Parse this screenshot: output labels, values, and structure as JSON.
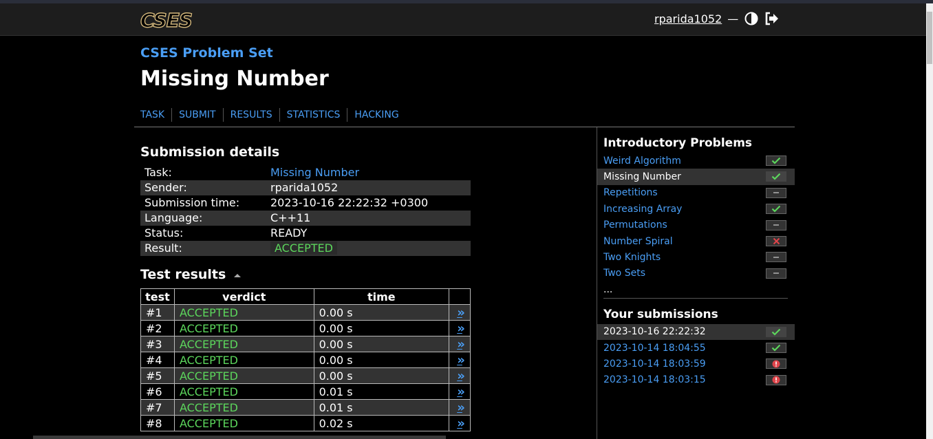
{
  "header": {
    "logo": "CSES",
    "username": "rparida1052",
    "separator": "—",
    "theme_icon": "contrast-icon",
    "logout_icon": "logout-icon"
  },
  "breadcrumb": "CSES Problem Set",
  "page_title": "Missing Number",
  "tabs": [
    {
      "label": "TASK"
    },
    {
      "label": "SUBMIT"
    },
    {
      "label": "RESULTS"
    },
    {
      "label": "STATISTICS"
    },
    {
      "label": "HACKING"
    }
  ],
  "details": {
    "heading": "Submission details",
    "task_label": "Task:",
    "task_value": "Missing Number",
    "sender_label": "Sender:",
    "sender_value": "rparida1052",
    "time_label": "Submission time:",
    "time_value": "2023-10-16 22:22:32 +0300",
    "language_label": "Language:",
    "language_value": "C++11",
    "status_label": "Status:",
    "status_value": "READY",
    "result_label": "Result:",
    "result_value": "ACCEPTED"
  },
  "tests": {
    "heading": "Test results",
    "columns": [
      "test",
      "verdict",
      "time"
    ],
    "link_glyph": "»",
    "rows": [
      {
        "test": "#1",
        "verdict": "ACCEPTED",
        "time": "0.00 s"
      },
      {
        "test": "#2",
        "verdict": "ACCEPTED",
        "time": "0.00 s"
      },
      {
        "test": "#3",
        "verdict": "ACCEPTED",
        "time": "0.00 s"
      },
      {
        "test": "#4",
        "verdict": "ACCEPTED",
        "time": "0.00 s"
      },
      {
        "test": "#5",
        "verdict": "ACCEPTED",
        "time": "0.00 s"
      },
      {
        "test": "#6",
        "verdict": "ACCEPTED",
        "time": "0.01 s"
      },
      {
        "test": "#7",
        "verdict": "ACCEPTED",
        "time": "0.01 s"
      },
      {
        "test": "#8",
        "verdict": "ACCEPTED",
        "time": "0.02 s"
      }
    ]
  },
  "sidebar": {
    "problems_heading": "Introductory Problems",
    "problems": [
      {
        "label": "Weird Algorithm",
        "status": "check"
      },
      {
        "label": "Missing Number",
        "status": "check",
        "current": true
      },
      {
        "label": "Repetitions",
        "status": "dash"
      },
      {
        "label": "Increasing Array",
        "status": "check"
      },
      {
        "label": "Permutations",
        "status": "dash"
      },
      {
        "label": "Number Spiral",
        "status": "cross"
      },
      {
        "label": "Two Knights",
        "status": "dash"
      },
      {
        "label": "Two Sets",
        "status": "dash"
      }
    ],
    "more": "...",
    "submissions_heading": "Your submissions",
    "submissions": [
      {
        "label": "2023-10-16 22:22:32",
        "status": "check",
        "current": true
      },
      {
        "label": "2023-10-14 18:04:55",
        "status": "check"
      },
      {
        "label": "2023-10-14 18:03:59",
        "status": "error"
      },
      {
        "label": "2023-10-14 18:03:15",
        "status": "error"
      }
    ]
  },
  "colors": {
    "link": "#4a9ef5",
    "accepted": "#5cd65c",
    "error": "#e0444a",
    "logo": "#d3b77c"
  }
}
